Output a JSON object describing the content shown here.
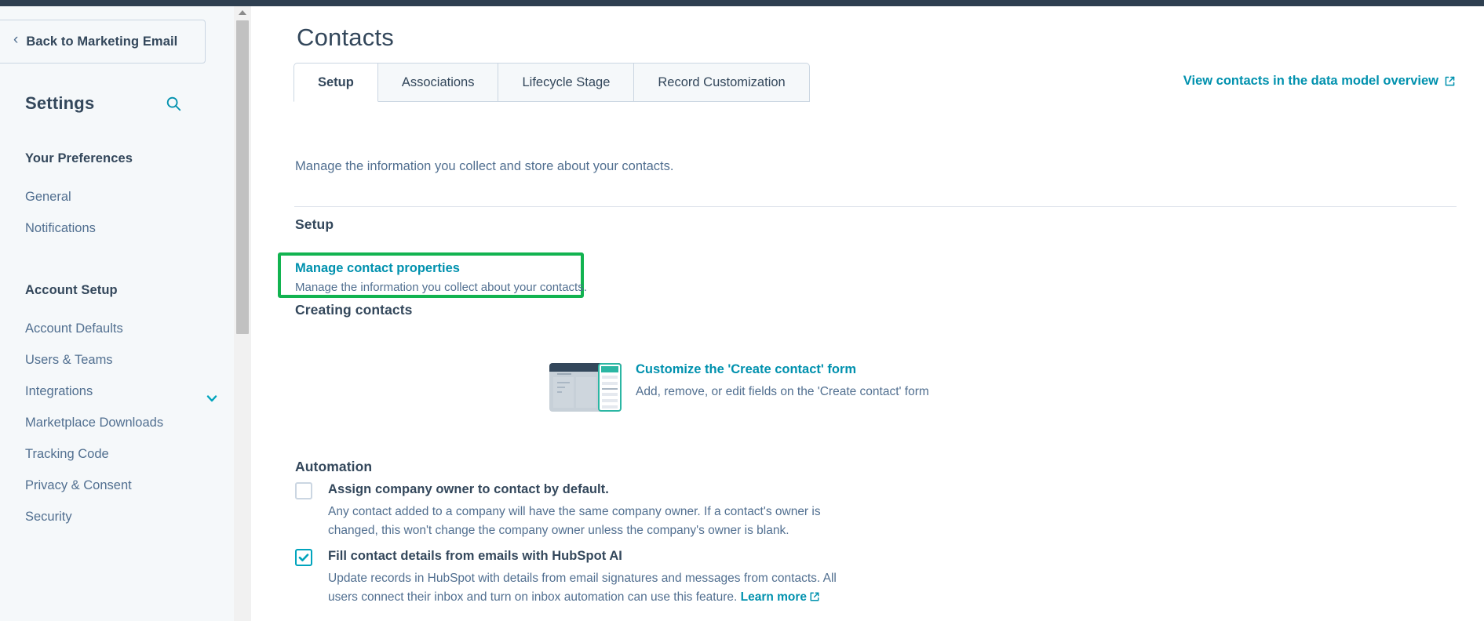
{
  "topbar": {
    "color": "#2e3f50"
  },
  "sidebar": {
    "back_button": {
      "label": "Back to Marketing Email",
      "icon": "chevron-left-icon"
    },
    "title": "Settings",
    "search_icon": "search-icon",
    "sections": [
      {
        "heading": "Your Preferences",
        "items": [
          {
            "label": "General",
            "expandable": false
          },
          {
            "label": "Notifications",
            "expandable": false
          }
        ]
      },
      {
        "heading": "Account Setup",
        "items": [
          {
            "label": "Account Defaults",
            "expandable": false
          },
          {
            "label": "Users & Teams",
            "expandable": false
          },
          {
            "label": "Integrations",
            "expandable": true
          },
          {
            "label": "Marketplace Downloads",
            "expandable": false
          },
          {
            "label": "Tracking Code",
            "expandable": false
          },
          {
            "label": "Privacy & Consent",
            "expandable": false
          },
          {
            "label": "Security",
            "expandable": false
          }
        ]
      }
    ]
  },
  "main": {
    "page_title": "Contacts",
    "tabs": [
      {
        "label": "Setup",
        "active": true
      },
      {
        "label": "Associations",
        "active": false
      },
      {
        "label": "Lifecycle Stage",
        "active": false
      },
      {
        "label": "Record Customization",
        "active": false
      }
    ],
    "data_model_link": "View contacts in the data model overview",
    "intro": "Manage the information you collect and store about your contacts.",
    "setup": {
      "heading": "Setup",
      "card": {
        "link": "Manage contact properties",
        "description": "Manage the information you collect about your contacts.",
        "highlight_color": "#12b350"
      }
    },
    "creating_contacts": {
      "heading": "Creating contacts",
      "link": "Customize the 'Create contact' form",
      "description": "Add, remove, or edit fields on the 'Create contact' form"
    },
    "automation": {
      "heading": "Automation",
      "options": [
        {
          "checked": false,
          "title": "Assign company owner to contact by default.",
          "description": "Any contact added to a company will have the same company owner. If a contact's owner is changed, this won't change the company owner unless the company's owner is blank."
        },
        {
          "checked": true,
          "title": "Fill contact details from emails with HubSpot AI",
          "description": "Update records in HubSpot with details from email signatures and messages from contacts. All users connect their inbox and turn on inbox automation can use this feature.",
          "link_label": "Learn more"
        }
      ]
    }
  },
  "colors": {
    "accent_teal": "#0091ae",
    "checkbox_teal": "#00a4bd",
    "text_dark": "#33475b",
    "text_muted": "#516f90",
    "sidebar_bg": "#f5f8fa",
    "highlight_green": "#12b350"
  }
}
